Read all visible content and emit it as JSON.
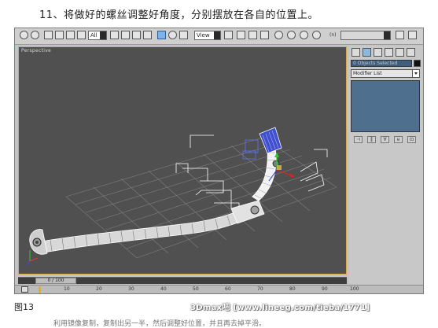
{
  "caption": "11、将做好的螺丝调整好角度，分别摆放在各自的位置上。",
  "toolbar": {
    "selection_filter": "All",
    "ref_coord": "View",
    "named_selection": "",
    "snap_label": "(n)"
  },
  "viewport": {
    "label": "Perspective"
  },
  "command_panel": {
    "object_field": "0 Objects Selected",
    "modifier_list": "Modifier List",
    "stack_buttons": [
      "⊣",
      "‖",
      "∀",
      "⊌",
      "⊡"
    ]
  },
  "timeline": {
    "slider": "0 / 100",
    "ticks": [
      "10",
      "20",
      "30",
      "40",
      "50",
      "60",
      "70",
      "80",
      "90",
      "100"
    ]
  },
  "figure_label": "图13",
  "watermark": "3Dmax吧 [www.lineeg.com/tieba/1771]",
  "bottom_text": "利用镜像复制，复制出另一半，然后调整好位置，并且再去掉平滑。"
}
